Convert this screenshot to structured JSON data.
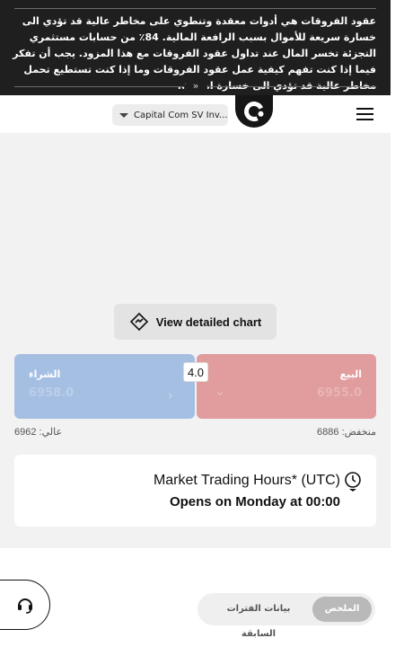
{
  "risk_banner": {
    "text": "عقود الفروقات هي أدوات معقدة وتنطوي على مخاطر عالية قد تؤدي الى خسارة سريعة للأموال بسبب الرافعة المالية. 84٪ من حسابات مستثمري التجزئة تخسر المال عند تداول عقود الفروقات مع هذا المزود. يجب أن تفكر فيما إذا كنت تفهم كيفية عمل عقود الفروقات وما إذا كنت تستطيع تحمل مخاطر عالية قد تؤدي الى خسارة اموالك.",
    "toggle": "»"
  },
  "header": {
    "entity_select": "Capital Com SV Inv...",
    "logo_icon": "capital-com-logo",
    "menu_icon": "hamburger-menu-icon"
  },
  "chart": {
    "view_detailed_label": "View detailed chart",
    "icon": "chart-diamond-icon"
  },
  "trade": {
    "buy": {
      "label": "الشراء",
      "price": "6958.0"
    },
    "sell": {
      "label": "البيع",
      "price": "6955.0"
    },
    "spread": "4.0"
  },
  "range": {
    "high": "عالي: 6962",
    "low": "منخفض: 6886"
  },
  "market_hours": {
    "title": "Market Trading Hours* (UTC)",
    "status": "Opens on Monday at 00:00",
    "icon": "clock-icon"
  },
  "support": {
    "icon": "headset-icon"
  },
  "tabs": [
    {
      "label": "الملخص",
      "active": true
    },
    {
      "label": "بيانات الفترات السابقة",
      "active": false
    }
  ],
  "colors": {
    "buy": "#a5bfe3",
    "sell": "#e19c9d",
    "banner": "#1f1f1f"
  }
}
